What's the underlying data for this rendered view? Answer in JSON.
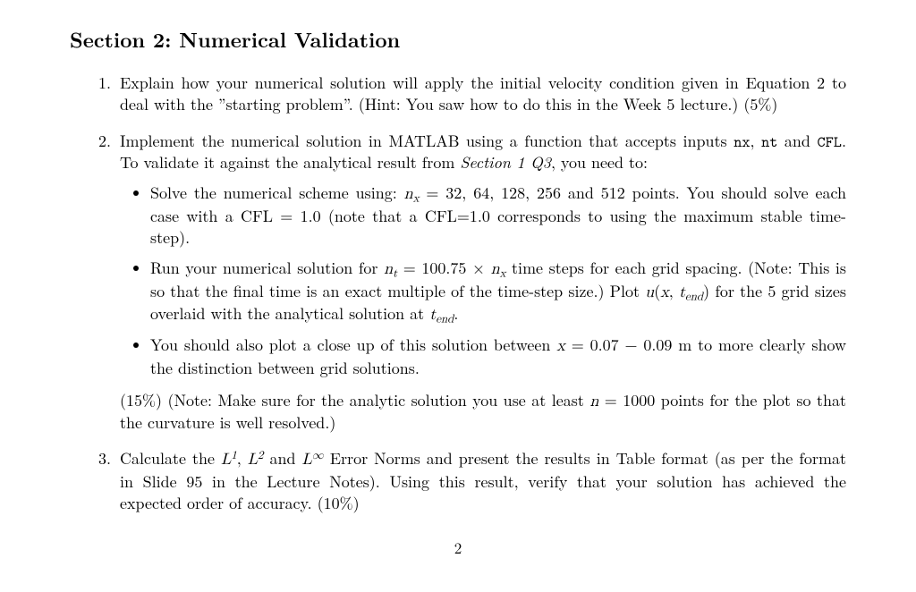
{
  "section_title": "Section 2: Numerical Validation",
  "q1": {
    "text_a": "Explain how your numerical solution will apply the initial velocity condition given in Equation 2 to deal with the ”starting problem”. (Hint: You saw how to do this in the Week 5 lecture.) (5%)"
  },
  "q2": {
    "intro_a": "Implement the numerical solution in MATLAB using a function that accepts inputs ",
    "intro_nx": "nx",
    "intro_b": ", ",
    "intro_nt": "nt",
    "intro_c": " and ",
    "intro_cfl": "CFL",
    "intro_d": ". To validate it against the analytical result from ",
    "intro_sec": "Section 1 Q3",
    "intro_e": ", you need to:",
    "b1": {
      "a": "Solve the numerical scheme using: ",
      "nx": "n",
      "nxsub": "x",
      "b": " = 32, 64, 128, 256 and 512 points. You should solve each case with a CFL = 1.0 (note that a CFL=1.0 corresponds to using the maximum stable time-step)."
    },
    "b2": {
      "a": "Run your numerical solution for ",
      "nt": "n",
      "ntsub": "t",
      "b": " = 100.75 × ",
      "nx": "n",
      "nxsub": "x",
      "c": " time steps for each grid spacing. (Note: This is so that the final time is an exact multiple of the time-step size.) Plot ",
      "u": "u",
      "paren_open": "(",
      "x": "x",
      "comma": ", ",
      "t": "t",
      "tsub": "end",
      "paren_close": ")",
      "d": " for the 5 grid sizes overlaid with the analytical solution at ",
      "t2": "t",
      "t2sub": "end",
      "e": "."
    },
    "b3": {
      "a": "You should also plot a close up of this solution between ",
      "x": "x",
      "b": " = 0.07 − 0.09 m to more clearly show the distinction between grid solutions."
    },
    "trailer": {
      "a": "(15%) (Note: Make sure for the analytic solution you use at least ",
      "n": "n",
      "b": " = 1000 points for the plot so that the curvature is well resolved.)"
    }
  },
  "q3": {
    "a": "Calculate the ",
    "L": "L",
    "sup1": "1",
    "b": ", ",
    "sup2": "2",
    "c": " and ",
    "supinf": "∞",
    "d": " Error Norms and present the results in Table format (as per the format in Slide 95 in the Lecture Notes). Using this result, verify that your solution has achieved the expected order of accuracy. (10%)"
  },
  "pagenum": "2"
}
